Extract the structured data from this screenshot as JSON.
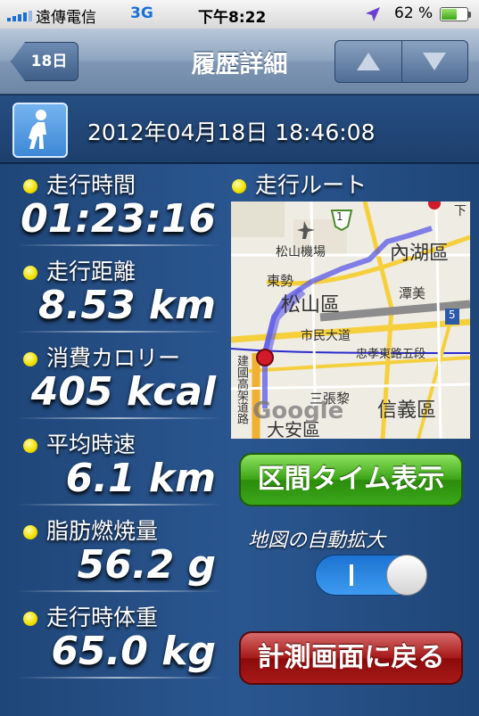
{
  "status_bar": {
    "carrier": "遠傳電信",
    "network": "3G",
    "time": "下午8:22",
    "battery_text": "62 %",
    "battery_level": 0.62,
    "accent": "#1a6fd6"
  },
  "nav": {
    "back_label": "18日",
    "title": "履歴詳細",
    "up_icon": "arrow-up-icon",
    "down_icon": "arrow-down-icon"
  },
  "record": {
    "activity_icon": "walking-person-icon",
    "datetime": "2012年04月18日 18:46:08"
  },
  "stats": [
    {
      "label": "走行時間",
      "value": "01:23:16"
    },
    {
      "label": "走行距離",
      "value": "8.53 km"
    },
    {
      "label": "消費カロリー",
      "value": "405 kcal"
    },
    {
      "label": "平均時速",
      "value": "6.1 km"
    },
    {
      "label": "脂肪燃焼量",
      "value": "56.2 g"
    },
    {
      "label": "走行時体重",
      "value": "65.0 kg"
    }
  ],
  "route": {
    "label": "走行ルート",
    "map_labels": {
      "airport": "松山機場",
      "dongshi": "東勢",
      "songshan": "松山區",
      "neihu": "內湖區",
      "tanmei": "潭美",
      "civic": "市民大道",
      "zhongxiao": "忠孝東路五段",
      "jianguo": "建國高架道路",
      "sanzhangli": "三張黎",
      "xinyi": "信義區",
      "daan": "大安區",
      "google": "Google",
      "route1": "1",
      "route5": "5",
      "xia": "下"
    }
  },
  "buttons": {
    "segment_time": "区間タイム表示",
    "auto_zoom_label": "地図の自動拡大",
    "toggle_on_symbol": "I",
    "back_to_measure": "計測画面に戻る"
  },
  "colors": {
    "green_button": "#3aa315",
    "red_button": "#a51818",
    "toggle_on": "#1d73d3",
    "route_line": "#5a5ae8"
  }
}
